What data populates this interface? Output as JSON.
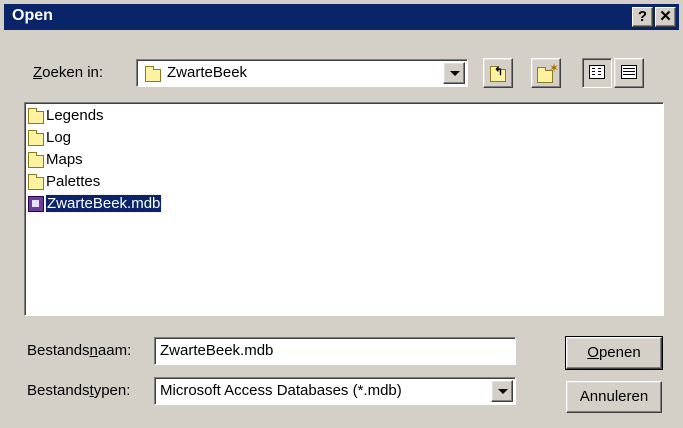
{
  "window": {
    "title": "Open",
    "help_label": "?",
    "close_label": "✕"
  },
  "lookin": {
    "label_pre": "",
    "label_u": "Z",
    "label_post": "oeken in:",
    "value": "ZwarteBeek"
  },
  "files": [
    {
      "name": "Legends",
      "type": "folder"
    },
    {
      "name": "Log",
      "type": "folder"
    },
    {
      "name": "Maps",
      "type": "folder"
    },
    {
      "name": "Palettes",
      "type": "folder"
    },
    {
      "name": "ZwarteBeek.mdb",
      "type": "access-database",
      "selected": true
    }
  ],
  "filename": {
    "label_pre": "Bestands",
    "label_u": "n",
    "label_post": "aam:",
    "value": "ZwarteBeek.mdb"
  },
  "filetype": {
    "label_pre": "Bestands",
    "label_u": "t",
    "label_post": "ypen:",
    "value": "Microsoft Access Databases (*.mdb)"
  },
  "buttons": {
    "open_u": "O",
    "open_rest": "penen",
    "cancel": "Annuleren"
  }
}
